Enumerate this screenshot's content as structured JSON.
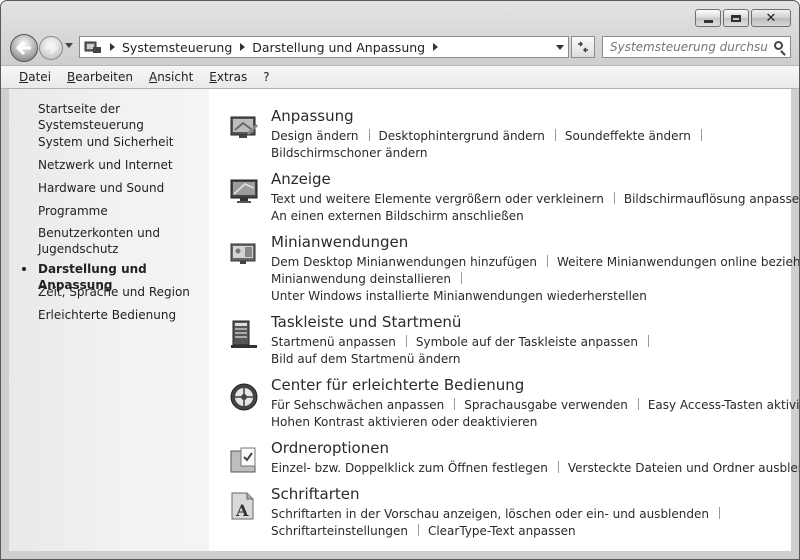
{
  "address": {
    "crumbs": [
      "Systemsteuerung",
      "Darstellung und Anpassung"
    ],
    "search_placeholder": "Systemsteuerung durchsuch..."
  },
  "menu": [
    "Datei",
    "Bearbeiten",
    "Ansicht",
    "Extras",
    "?"
  ],
  "sidebar": {
    "home": "Startseite der Systemsteuerung",
    "items": [
      "System und Sicherheit",
      "Netzwerk und Internet",
      "Hardware und Sound",
      "Programme",
      "Benutzerkonten und Jugendschutz",
      "Darstellung und Anpassung",
      "Zeit, Sprache und Region",
      "Erleichterte Bedienung"
    ],
    "active_index": 5
  },
  "groups": [
    {
      "title": "Anpassung",
      "icon": "personalization-icon",
      "lines": [
        [
          "Design ändern",
          "Desktophintergrund ändern",
          "Soundeffekte ändern"
        ],
        [
          "Bildschirmschoner ändern"
        ]
      ]
    },
    {
      "title": "Anzeige",
      "icon": "display-icon",
      "lines": [
        [
          "Text und weitere Elemente vergrößern oder verkleinern",
          "Bildschirmauflösung anpassen"
        ],
        [
          "An einen externen Bildschirm anschließen"
        ]
      ]
    },
    {
      "title": "Minianwendungen",
      "icon": "gadgets-icon",
      "lines": [
        [
          "Dem Desktop Minianwendungen hinzufügen",
          "Weitere Minianwendungen online beziehen"
        ],
        [
          "Minianwendung deinstallieren"
        ],
        [
          "Unter Windows installierte Minianwendungen wiederherstellen"
        ]
      ]
    },
    {
      "title": "Taskleiste und Startmenü",
      "icon": "taskbar-icon",
      "lines": [
        [
          "Startmenü anpassen",
          "Symbole auf der Taskleiste anpassen"
        ],
        [
          "Bild auf dem Startmenü ändern"
        ]
      ]
    },
    {
      "title": "Center für erleichterte Bedienung",
      "icon": "ease-of-access-icon",
      "lines": [
        [
          "Für Sehschwächen anpassen",
          "Sprachausgabe verwenden",
          "Easy Access-Tasten aktivieren"
        ],
        [
          "Hohen Kontrast aktivieren oder deaktivieren"
        ]
      ]
    },
    {
      "title": "Ordneroptionen",
      "icon": "folder-options-icon",
      "lines": [
        [
          "Einzel- bzw. Doppelklick zum Öffnen festlegen",
          "Versteckte Dateien und Ordner ausblenden"
        ]
      ]
    },
    {
      "title": "Schriftarten",
      "icon": "fonts-icon",
      "lines": [
        [
          "Schriftarten in der Vorschau anzeigen, löschen oder ein- und ausblenden"
        ],
        [
          "Schriftarteinstellungen",
          "ClearType-Text anpassen"
        ]
      ]
    }
  ]
}
